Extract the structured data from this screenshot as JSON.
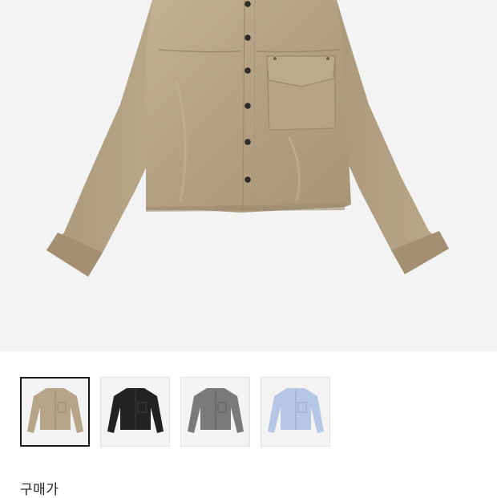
{
  "product": {
    "main_image": {
      "icon": "shirt-main-image",
      "color": "#b4a184"
    },
    "thumbnails": [
      {
        "color": "#b6a588",
        "selected": true
      },
      {
        "color": "#222222",
        "selected": false
      },
      {
        "color": "#7a7a7a",
        "selected": false
      },
      {
        "color": "#b7c8e6",
        "selected": false
      }
    ]
  },
  "price": {
    "label": "구매가"
  }
}
